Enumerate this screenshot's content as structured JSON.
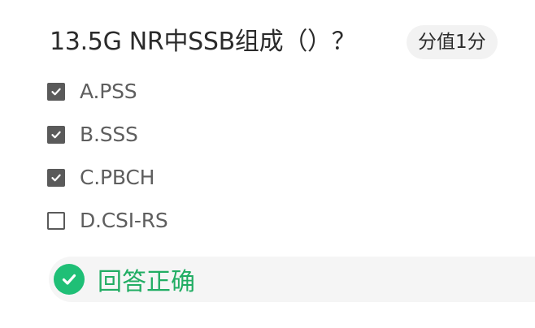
{
  "question": {
    "title": "13.5G NR中SSB组成（）？",
    "score_label": "分值1分"
  },
  "options": [
    {
      "label": "A.PSS",
      "checked": true
    },
    {
      "label": "B.SSS",
      "checked": true
    },
    {
      "label": "C.PBCH",
      "checked": true
    },
    {
      "label": "D.CSI-RS",
      "checked": false
    }
  ],
  "result": {
    "text": "回答正确",
    "icon": "check-circle-icon",
    "color": "#1fbf76"
  },
  "colors": {
    "checkbox": "#5a5a5a",
    "badge_bg": "#f2f2f2",
    "result_bg": "#f5f5f5",
    "result_text": "#21ad63"
  }
}
